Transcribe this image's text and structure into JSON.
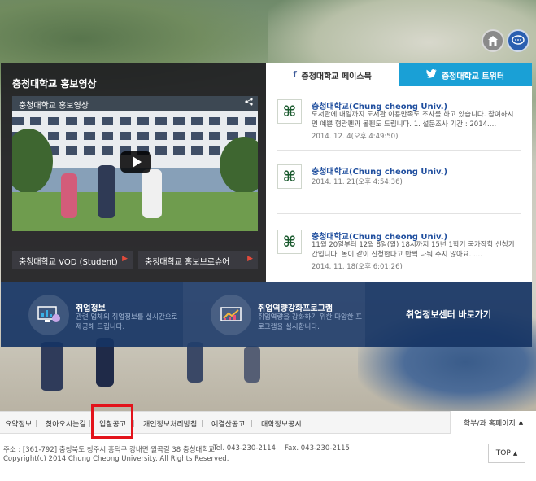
{
  "icons": {
    "home": "home-icon",
    "chat": "chat-icon",
    "share": "share-icon",
    "play": "play-icon",
    "facebook": "facebook-icon",
    "twitter": "twitter-icon"
  },
  "video": {
    "section_title": "충청대학교 홍보영상",
    "player_title": "충청대학교 홍보영상",
    "links": [
      {
        "label": "충청대학교 VOD (Student)",
        "arrow": "▶"
      },
      {
        "label": "충청대학교 홍보브로슈어",
        "arrow": "▶"
      }
    ]
  },
  "sns": {
    "tabs": [
      {
        "label": "충청대학교 페이스북",
        "glyph": "f"
      },
      {
        "label": "충청대학교 트위터",
        "glyph": "🐦"
      }
    ],
    "posts": [
      {
        "name": "충청대학교(Chung cheong Univ.)",
        "text": "도서관에 내일까지 도서관 이용만족도 조사를 하고 있습니다. 참여하시면 예쁜 형광펜과 볼펜도 드립니다. 1. 설문조사 기간 : 2014.…",
        "date": "2014. 12. 4(오후 4:49:50)"
      },
      {
        "name": "충청대학교(Chung cheong Univ.)",
        "text": "",
        "date": "2014. 11. 21(오후 4:54:36)"
      },
      {
        "name": "충청대학교(Chung cheong Univ.)",
        "text": "11월 20일부터 12월 8일(월) 18시까지 15년 1학기 국가장학 신청기간입니다. 돌이 같이 신청한다고 반씩 나눠 주지 않아요. ....",
        "date": "2014. 11. 18(오후 6:01:26)"
      }
    ]
  },
  "jobs": {
    "item1": {
      "title": "취업정보",
      "desc": "관련 업체의 취업정보를 실시간으로 제공해 드립니다."
    },
    "item2": {
      "title": "취업역량강화프로그램",
      "desc": "취업역량을 강화하기 위한 다양한 프로그램을 실시합니다."
    },
    "center_link": "취업정보센터 바로가기"
  },
  "footer": {
    "nav": [
      "요약정보",
      "찾아오시는길",
      "입찰공고",
      "개인정보처리방침",
      "예결산공고",
      "대학정보공시"
    ],
    "dept_select": "학부/과 홈페이지",
    "dept_arrow": "▲",
    "address": "주소 : [361-792] 충청북도 청주시 흥덕구 강내면 월곡길 38 충청대학교",
    "tel": "Tel. 043-230-2114",
    "fax": "Fax. 043-230-2115",
    "copyright": "Copyright(c) 2014 Chung Cheong University. All Rights Reserved.",
    "top_button": "TOP",
    "top_arrow": "▲"
  },
  "colors": {
    "twitter_tab": "#1aa0d6",
    "job_strip": "#163464",
    "highlight": "#e3131b",
    "post_name": "#1f4e9e"
  }
}
